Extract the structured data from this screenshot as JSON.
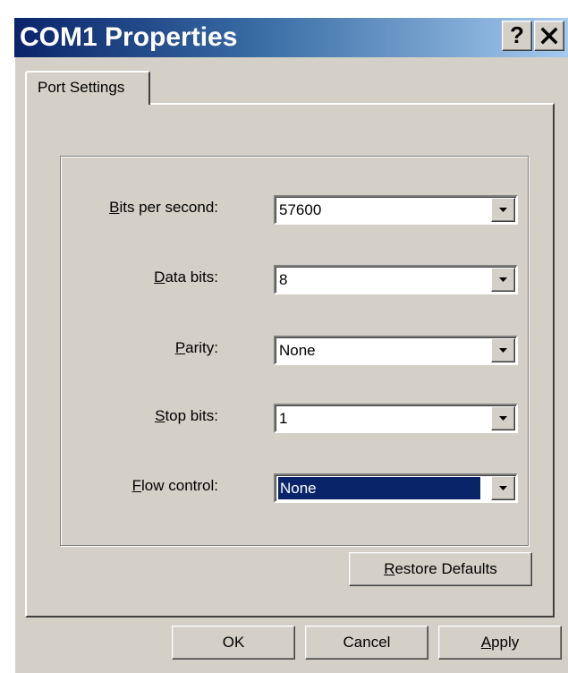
{
  "window": {
    "title": "COM1 Properties",
    "help_glyph": "?",
    "close_glyph": "✕"
  },
  "tabs": [
    {
      "label": "Port Settings",
      "active": true
    }
  ],
  "fields": [
    {
      "label_prefix": "",
      "label_accel": "B",
      "label_rest": "its per second:",
      "value": "57600",
      "selected": false
    },
    {
      "label_prefix": "",
      "label_accel": "D",
      "label_rest": "ata bits:",
      "value": "8",
      "selected": false
    },
    {
      "label_prefix": "",
      "label_accel": "P",
      "label_rest": "arity:",
      "value": "None",
      "selected": false
    },
    {
      "label_prefix": "",
      "label_accel": "S",
      "label_rest": "top bits:",
      "value": "1",
      "selected": false
    },
    {
      "label_prefix": "",
      "label_accel": "F",
      "label_rest": "low control:",
      "value": "None",
      "selected": true
    }
  ],
  "buttons": {
    "restore_accel": "R",
    "restore_rest": "estore Defaults",
    "ok": "OK",
    "cancel": "Cancel",
    "apply_accel": "A",
    "apply_rest": "pply"
  },
  "colors": {
    "face": "#d4d0c8",
    "titlebar_start": "#0a246a",
    "titlebar_end": "#a6caf0",
    "selection": "#0a246a"
  },
  "icons": {
    "help": "help-icon",
    "close": "close-icon",
    "dropdown": "chevron-down-icon"
  }
}
